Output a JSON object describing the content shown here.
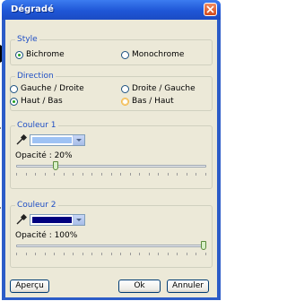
{
  "window": {
    "title": "Dégradé"
  },
  "style_group": {
    "title": "Style",
    "options": [
      {
        "label": "Bichrome",
        "checked": true
      },
      {
        "label": "Monochrome",
        "checked": false
      }
    ]
  },
  "direction_group": {
    "title": "Direction",
    "options": [
      {
        "label": "Gauche / Droite",
        "checked": false
      },
      {
        "label": "Droite / Gauche",
        "checked": false
      },
      {
        "label": "Haut / Bas",
        "checked": true
      },
      {
        "label": "Bas / Haut",
        "checked": false
      }
    ]
  },
  "color1_group": {
    "title": "Couleur 1",
    "color": "#9ec2f4",
    "opacity_label": "Opacité : 20%",
    "opacity_value": 0.2
  },
  "color2_group": {
    "title": "Couleur 2",
    "color": "#00007f",
    "opacity_label": "Opacité : 100%",
    "opacity_value": 1.0
  },
  "buttons": {
    "preview": "Aperçu",
    "ok": "Ok",
    "cancel": "Annuler"
  }
}
